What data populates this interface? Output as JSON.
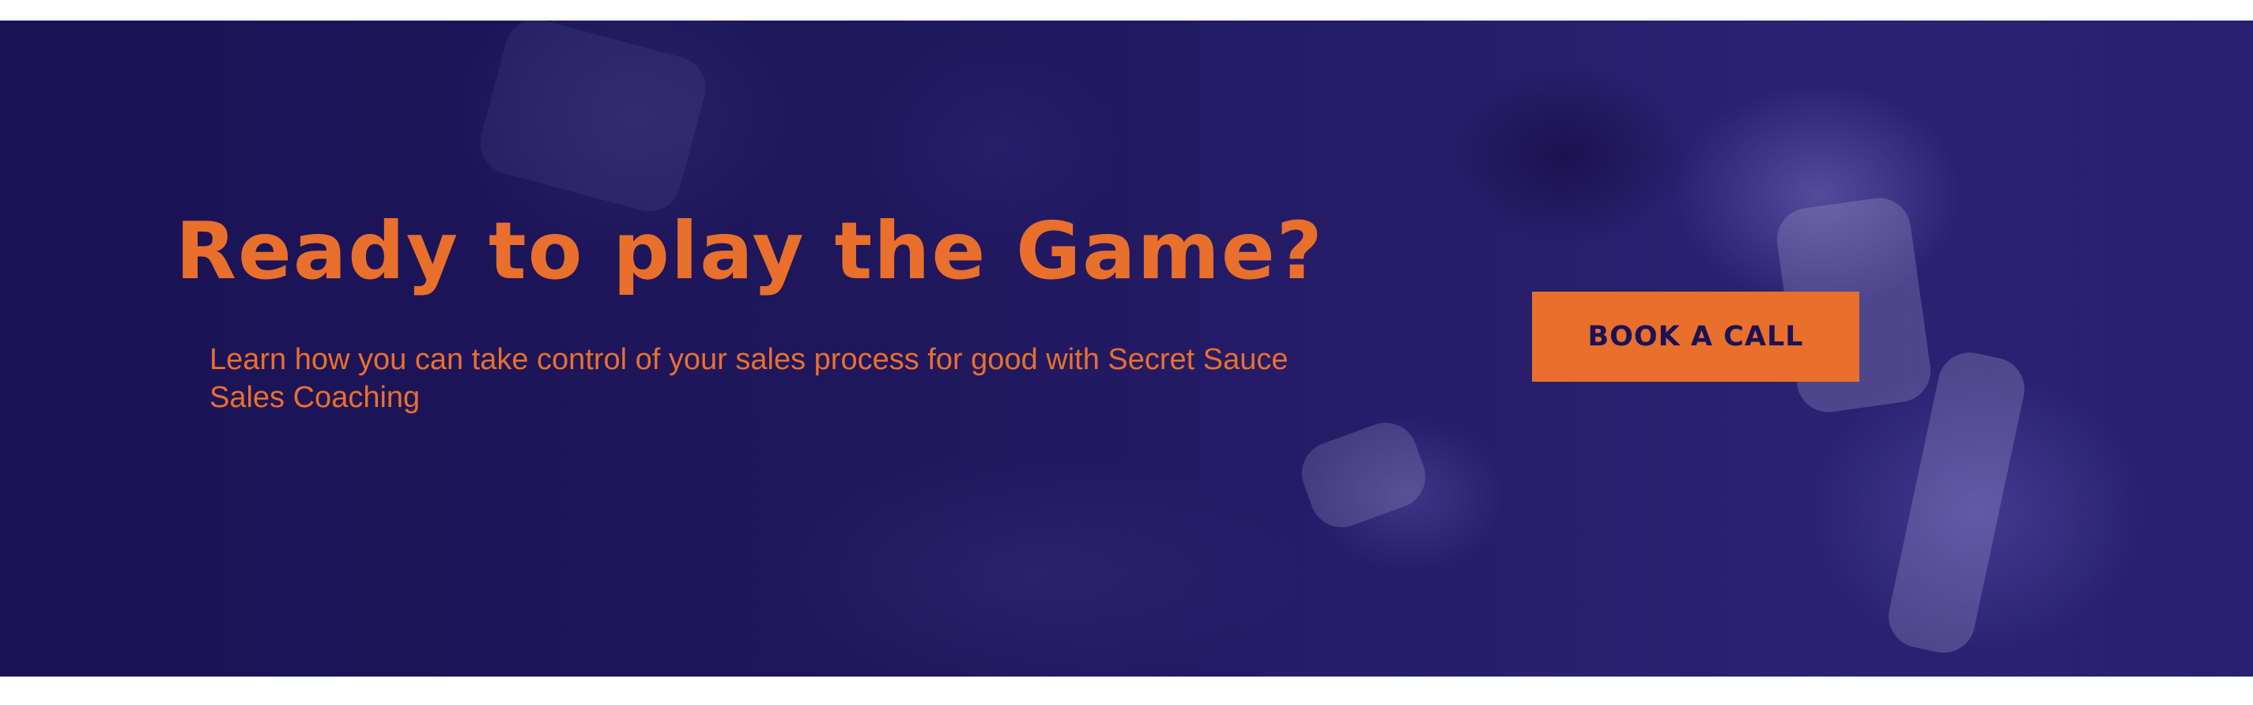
{
  "hero": {
    "headline": "Ready to play the Game?",
    "subtext": "Learn how you can take control of your sales process for good with Secret Sauce Sales Coaching",
    "cta_label": "BOOK A CALL",
    "background_image": "football-players-lineup",
    "colors": {
      "overlay": "#1b1255",
      "accent": "#e8702c",
      "button_text": "#1b1255"
    }
  }
}
